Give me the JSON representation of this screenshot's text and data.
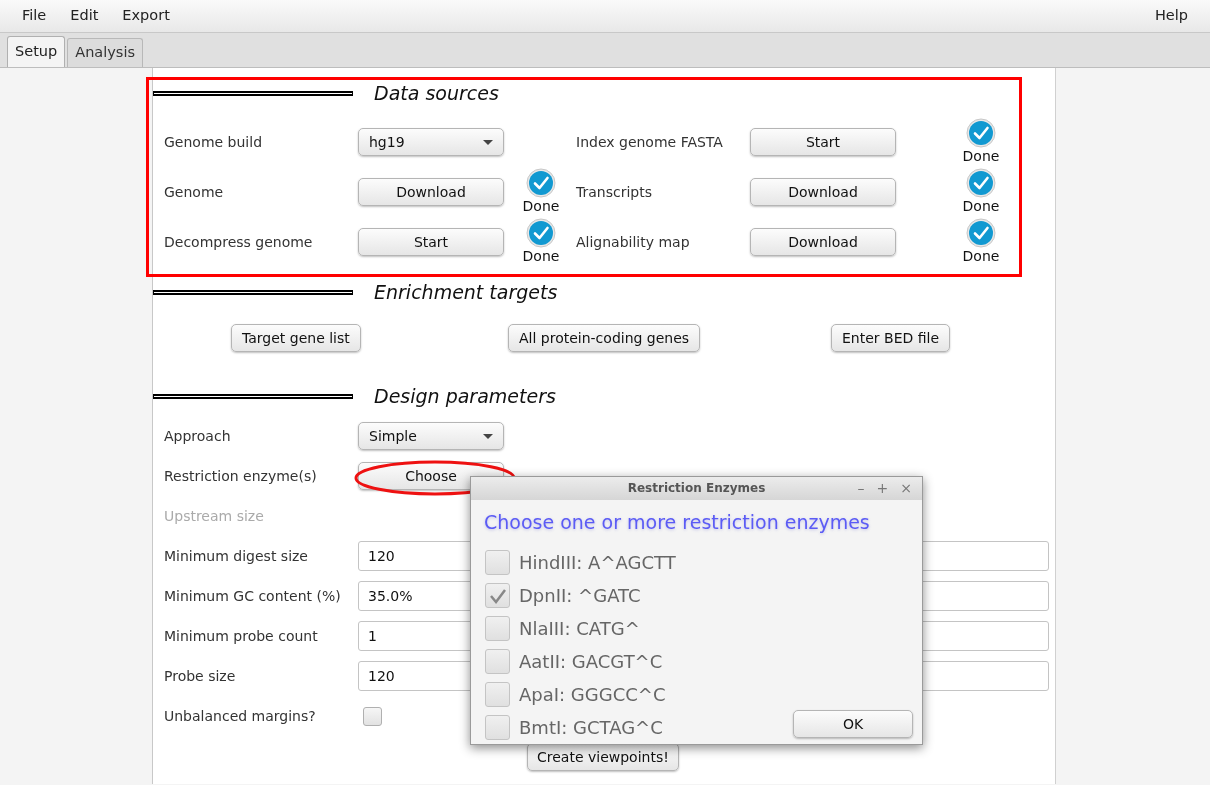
{
  "menu": [
    {
      "label": "File"
    },
    {
      "label": "Edit"
    },
    {
      "label": "Export"
    }
  ],
  "menu_right": [
    {
      "label": "Help"
    }
  ],
  "tabs": [
    {
      "label": "Setup",
      "selected": true
    },
    {
      "label": "Analysis",
      "selected": false
    }
  ],
  "data_sources": {
    "title": "Data sources",
    "highlighted": true,
    "left": [
      {
        "label": "Genome build",
        "control": {
          "kind": "select",
          "text": "hg19"
        }
      },
      {
        "label": "Genome",
        "control": {
          "kind": "button",
          "text": "Download"
        },
        "status": "Done"
      },
      {
        "label": "Decompress genome",
        "control": {
          "kind": "button",
          "text": "Start"
        },
        "status": "Done"
      }
    ],
    "right": [
      {
        "label": "Index genome FASTA",
        "control": {
          "kind": "button",
          "text": "Start"
        },
        "status": "Done"
      },
      {
        "label": "Transcripts",
        "control": {
          "kind": "button",
          "text": "Download"
        },
        "status": "Done"
      },
      {
        "label": "Alignability map",
        "control": {
          "kind": "button",
          "text": "Download"
        },
        "status": "Done"
      }
    ]
  },
  "enrichment_targets": {
    "title": "Enrichment targets",
    "buttons": [
      "Target gene list",
      "All protein-coding genes",
      "Enter BED file"
    ]
  },
  "design_parameters": {
    "title": "Design parameters",
    "rows": [
      {
        "label": "Approach",
        "kind": "select",
        "value": "Simple"
      },
      {
        "label": "Restriction enzyme(s)",
        "kind": "button",
        "value": "Choose",
        "highlighted": true
      },
      {
        "label": "Upstream size",
        "kind": "disabled"
      },
      {
        "label": "Minimum digest size",
        "kind": "field",
        "value": "120"
      },
      {
        "label": "Minimum GC content (%)",
        "kind": "field",
        "value": "35.0%"
      },
      {
        "label": "Minimum probe count",
        "kind": "field",
        "value": "1"
      },
      {
        "label": "Probe size",
        "kind": "field",
        "value": "120"
      },
      {
        "label": "Unbalanced margins?",
        "kind": "checkbox",
        "checked": false
      }
    ],
    "submit": "Create viewpoints!"
  },
  "dialog": {
    "title": "Restriction Enzymes",
    "controls": [
      "–",
      "+",
      "×"
    ],
    "heading": "Choose one or more restriction enzymes",
    "options": [
      {
        "label": "HindIII: A^AGCTT",
        "checked": false
      },
      {
        "label": "DpnII: ^GATC",
        "checked": true
      },
      {
        "label": "NlaIII: CATG^",
        "checked": false
      },
      {
        "label": "AatII: GACGT^C",
        "checked": false
      },
      {
        "label": "ApaI: GGGCC^C",
        "checked": false
      },
      {
        "label": "BmtI: GCTAG^C",
        "checked": false
      }
    ],
    "ok": "OK"
  }
}
